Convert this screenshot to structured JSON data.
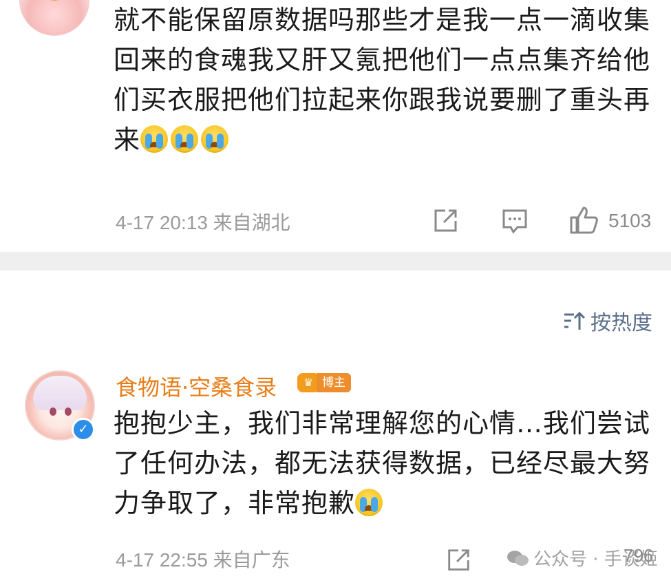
{
  "comment1": {
    "text": "就不能保留原数据吗那些才是我一点一滴收集回来的食魂我又肝又氪把他们一点点集齐给他们买衣服把他们拉起来你跟我说要删了重头再来",
    "emoji_icon": "crying-emoji-icon",
    "time": "4-17 20:13",
    "location": "来自湖北",
    "likes": "5103"
  },
  "sort": {
    "label": "按热度"
  },
  "comment2": {
    "username": "食物语·空桑食录",
    "badge": "博主",
    "text": "抱抱少主，我们非常理解您的心情…我们尝试了任何办法，都无法获得数据，已经尽最大努力争取了，非常抱歉",
    "time": "4-17 22:55",
    "location": "来自广东",
    "likes": "796"
  },
  "watermark": {
    "text": "公众号 · 手谈姬"
  },
  "colors": {
    "username": "#e87e1a",
    "meta": "#9a9a9a",
    "sort": "#5a6f8a",
    "divider": "#efefef"
  }
}
